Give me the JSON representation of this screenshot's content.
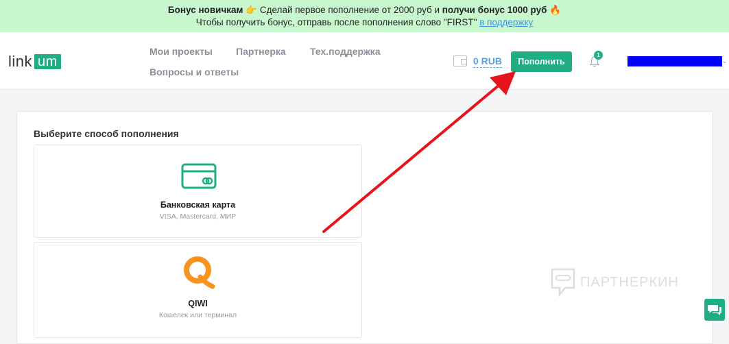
{
  "promo": {
    "line1_bold1": "Бонус новичкам",
    "line1_emoji1": "👉",
    "line1_text": " Сделай первое пополнение от 2000 руб и ",
    "line1_bold2": "получи бонус 1000 руб",
    "line1_emoji2": "🔥",
    "line2_text": "Чтобы получить бонус, отправь после пополнения слово \"FIRST\" ",
    "line2_link": "в поддержку"
  },
  "header": {
    "logo_text": "link",
    "logo_box": "um",
    "nav": [
      {
        "label": "Мои проекты"
      },
      {
        "label": "Партнерка"
      },
      {
        "label": "Тех.поддержка"
      },
      {
        "label": "Вопросы и ответы"
      }
    ],
    "balance": "0 RUB",
    "topup_label": "Пополнить",
    "notifications_count": "1",
    "user_caret": "⌄"
  },
  "main": {
    "title": "Выберите способ пополнения",
    "methods": [
      {
        "name": "Банковская карта",
        "sub": "VISA, Mastercard, МИР",
        "icon": "credit-card-icon"
      },
      {
        "name": "QIWI",
        "sub": "Кошелек или терминал",
        "icon": "qiwi-logo-icon"
      }
    ]
  },
  "watermark": "ПАРТНЕРКИН",
  "colors": {
    "accent": "#1fae84",
    "promo_bg": "#c9f7cd",
    "link": "#3d8fe0",
    "qiwi_orange": "#f7931e",
    "arrow_red": "#e8141c"
  }
}
